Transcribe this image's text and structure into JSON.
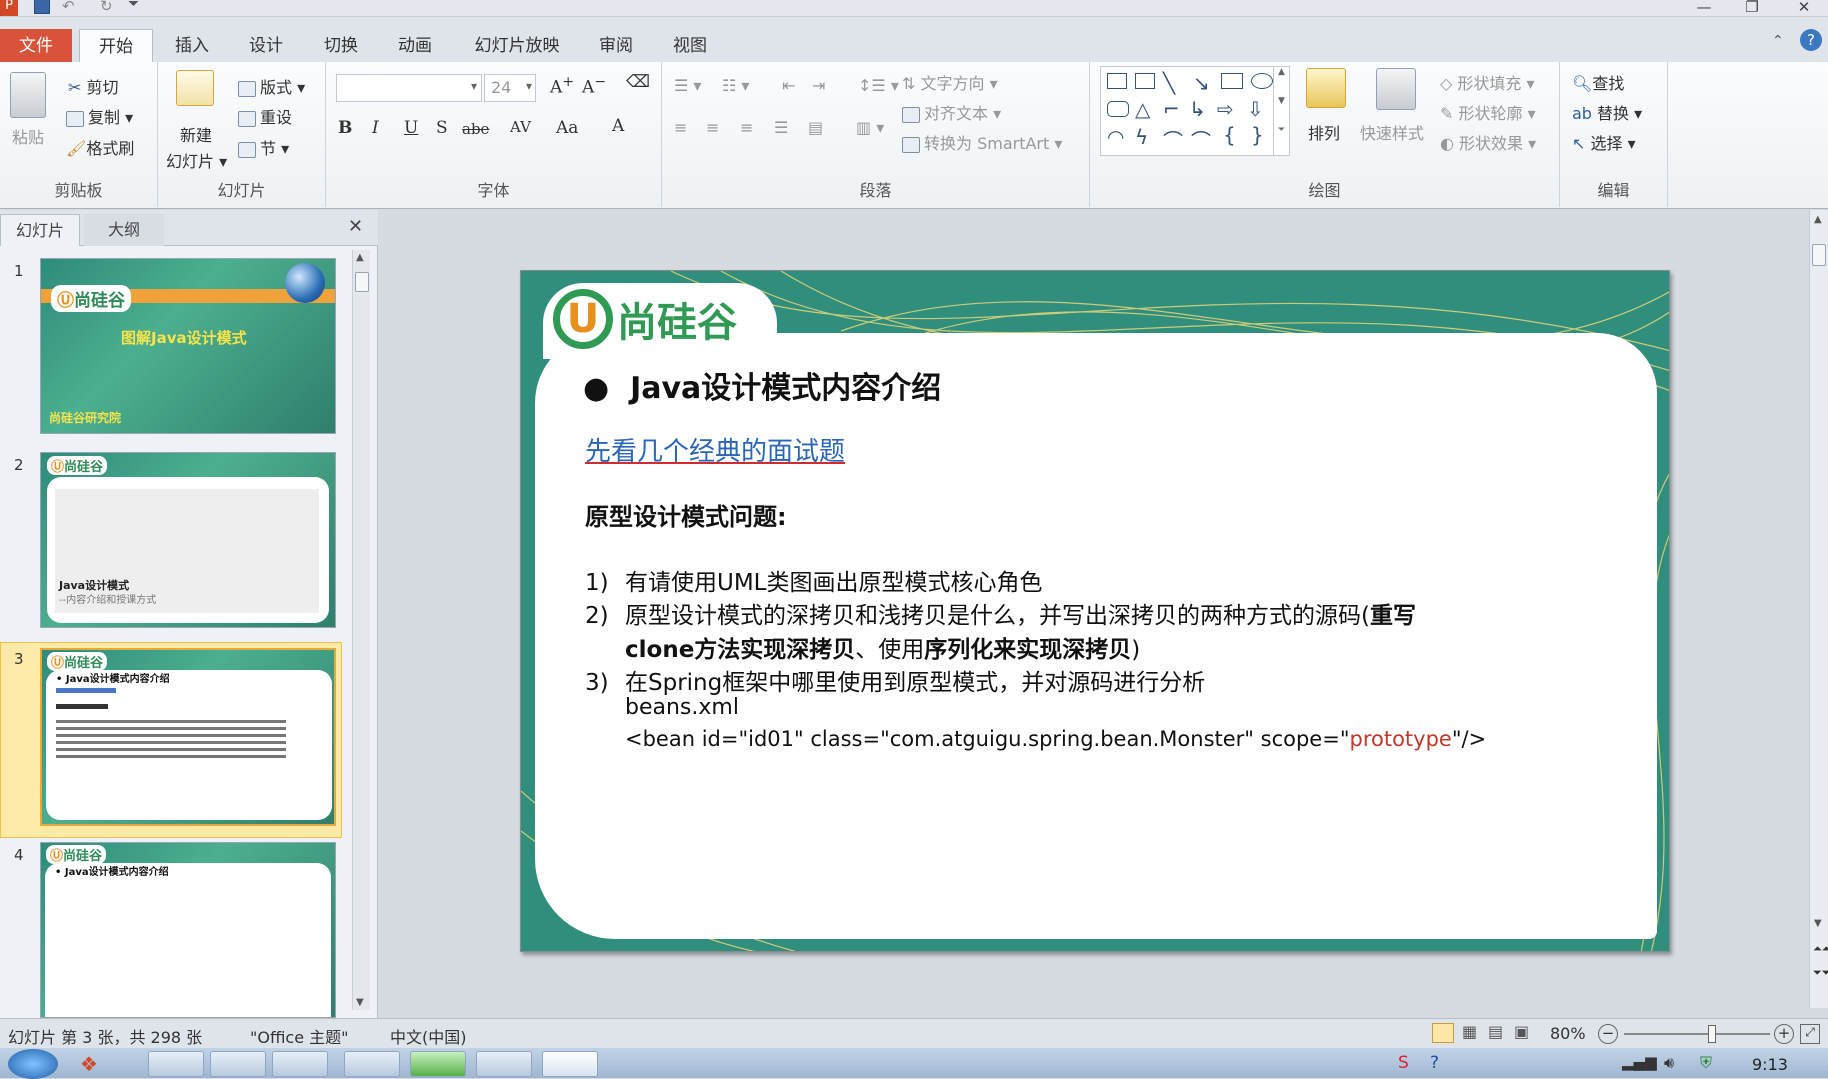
{
  "ribbon_tabs": [
    "文件",
    "开始",
    "插入",
    "设计",
    "切换",
    "动画",
    "幻灯片放映",
    "审阅",
    "视图"
  ],
  "clipboard": {
    "paste": "粘贴",
    "cut": "剪切",
    "copy": "复制",
    "format_painter": "格式刷",
    "label": "剪贴板"
  },
  "slides_group": {
    "new_slide_l1": "新建",
    "new_slide_l2": "幻灯片",
    "layout": "版式",
    "reset": "重设",
    "section": "节",
    "label": "幻灯片"
  },
  "font_group": {
    "font_size": "24",
    "label": "字体",
    "buttons": [
      "B",
      "I",
      "U",
      "S",
      "abe",
      "AV",
      "Aa",
      "A"
    ]
  },
  "paragraph_group": {
    "text_direction": "文字方向",
    "align_text": "对齐文本",
    "convert_smartart": "转换为 SmartArt",
    "label": "段落"
  },
  "drawing_group": {
    "arrange": "排列",
    "quick_styles": "快速样式",
    "shape_fill": "形状填充",
    "shape_outline": "形状轮廓",
    "shape_effects": "形状效果",
    "label": "绘图"
  },
  "editing_group": {
    "find": "查找",
    "replace": "替换",
    "select": "选择",
    "label": "编辑"
  },
  "pane_tabs": [
    "幻灯片",
    "大纲"
  ],
  "thumbnails": [
    {
      "num": "1",
      "logo": "尚硅谷",
      "title": "图解Java设计模式",
      "footer": "尚硅谷研究院"
    },
    {
      "num": "2",
      "logo": "尚硅谷",
      "line1": "Java设计模式",
      "line2": "--内容介绍和授课方式"
    },
    {
      "num": "3",
      "logo": "尚硅谷",
      "line1": "Java设计模式内容介绍"
    },
    {
      "num": "4",
      "logo": "尚硅谷",
      "line1": "Java设计模式内容介绍"
    }
  ],
  "slide": {
    "logo": "尚硅谷",
    "bullet": "Java设计模式内容介绍",
    "link": "先看几个经典的面试题",
    "heading": "原型设计模式问题:",
    "item1_num": "1)",
    "item1": "有请使用UML类图画出原型模式核心角色",
    "item2_num": "2)",
    "item2_a": "原型设计模式的深拷贝和浅拷贝是什么，并写出深拷贝的两种方式的源码(",
    "item2_b": "重写",
    "item2_c": "clone方法实现深拷贝",
    "item2_d": "、使用",
    "item2_e": "序列化来实现深拷贝",
    "item2_f": ")",
    "item3_num": "3)",
    "item3": "在Spring框架中哪里使用到原型模式，并对源码进行分析",
    "code1": "beans.xml",
    "code2_a": "<bean id=\"id01\" class=\"com.atguigu.spring.bean.Monster\"  scope=\"",
    "code2_b": "prototype",
    "code2_c": "\"/>"
  },
  "status": {
    "slide_info": "幻灯片 第 3 张，共 298 张",
    "theme": "\"Office 主题\"",
    "language": "中文(中国)",
    "zoom": "80%",
    "zoom_level": 0.6
  },
  "taskbar": {
    "time": "9:13"
  }
}
